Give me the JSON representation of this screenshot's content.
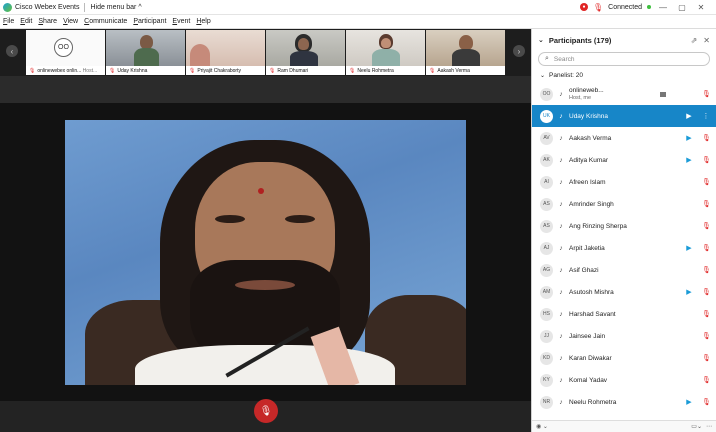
{
  "titlebar": {
    "app_title": "Cisco Webex Events",
    "hide_menu": "Hide menu bar",
    "status": "Connected",
    "minimize": "—",
    "maximize": "▢",
    "close": "✕"
  },
  "menu": [
    "File",
    "Edit",
    "Share",
    "View",
    "Communicate",
    "Participant",
    "Event",
    "Help"
  ],
  "thumbnails": [
    {
      "name": "onlinewebex onlin...",
      "initials": "OO",
      "host": "Host..."
    },
    {
      "name": "Uday Krishna"
    },
    {
      "name": "Priyajit Chakraborty"
    },
    {
      "name": "Ram Dhumari"
    },
    {
      "name": "Neelu Rohmetra"
    },
    {
      "name": "Aakash Verma"
    }
  ],
  "participants_panel": {
    "title": "Participants (179)",
    "search_placeholder": "Search",
    "group_label": "Panelist: 20",
    "rows": [
      {
        "initials": "OO",
        "name": "onlineweb...",
        "sub": "Host, me",
        "cam": false,
        "mic": true
      },
      {
        "initials": "UK",
        "name": "Uday Krishna",
        "cam": true,
        "mic": false,
        "selected": true
      },
      {
        "initials": "AV",
        "name": "Aakash Verma",
        "cam": true,
        "mic": true
      },
      {
        "initials": "AK",
        "name": "Aditya Kumar",
        "cam": true,
        "mic": true
      },
      {
        "initials": "AI",
        "name": "Afreen Islam",
        "cam": false,
        "mic": true
      },
      {
        "initials": "AS",
        "name": "Amrinder Singh",
        "cam": false,
        "mic": true
      },
      {
        "initials": "AS",
        "name": "Ang Rinzing Sherpa",
        "cam": false,
        "mic": true
      },
      {
        "initials": "AJ",
        "name": "Arpit Jaketia",
        "cam": true,
        "mic": true
      },
      {
        "initials": "AG",
        "name": "Asif Ghazi",
        "cam": false,
        "mic": true
      },
      {
        "initials": "AM",
        "name": "Asutosh Mishra",
        "cam": true,
        "mic": true
      },
      {
        "initials": "HS",
        "name": "Harshad Savant",
        "cam": false,
        "mic": true
      },
      {
        "initials": "JJ",
        "name": "Jainsee Jain",
        "cam": false,
        "mic": true
      },
      {
        "initials": "KD",
        "name": "Karan Diwakar",
        "cam": false,
        "mic": true
      },
      {
        "initials": "KY",
        "name": "Komal Yadav",
        "cam": false,
        "mic": true
      },
      {
        "initials": "NR",
        "name": "Neelu Rohmetra",
        "cam": true,
        "mic": true
      }
    ]
  },
  "colors": {
    "accent": "#1786c8",
    "mute": "#c62828",
    "video_bg": "#6f9cd0"
  }
}
